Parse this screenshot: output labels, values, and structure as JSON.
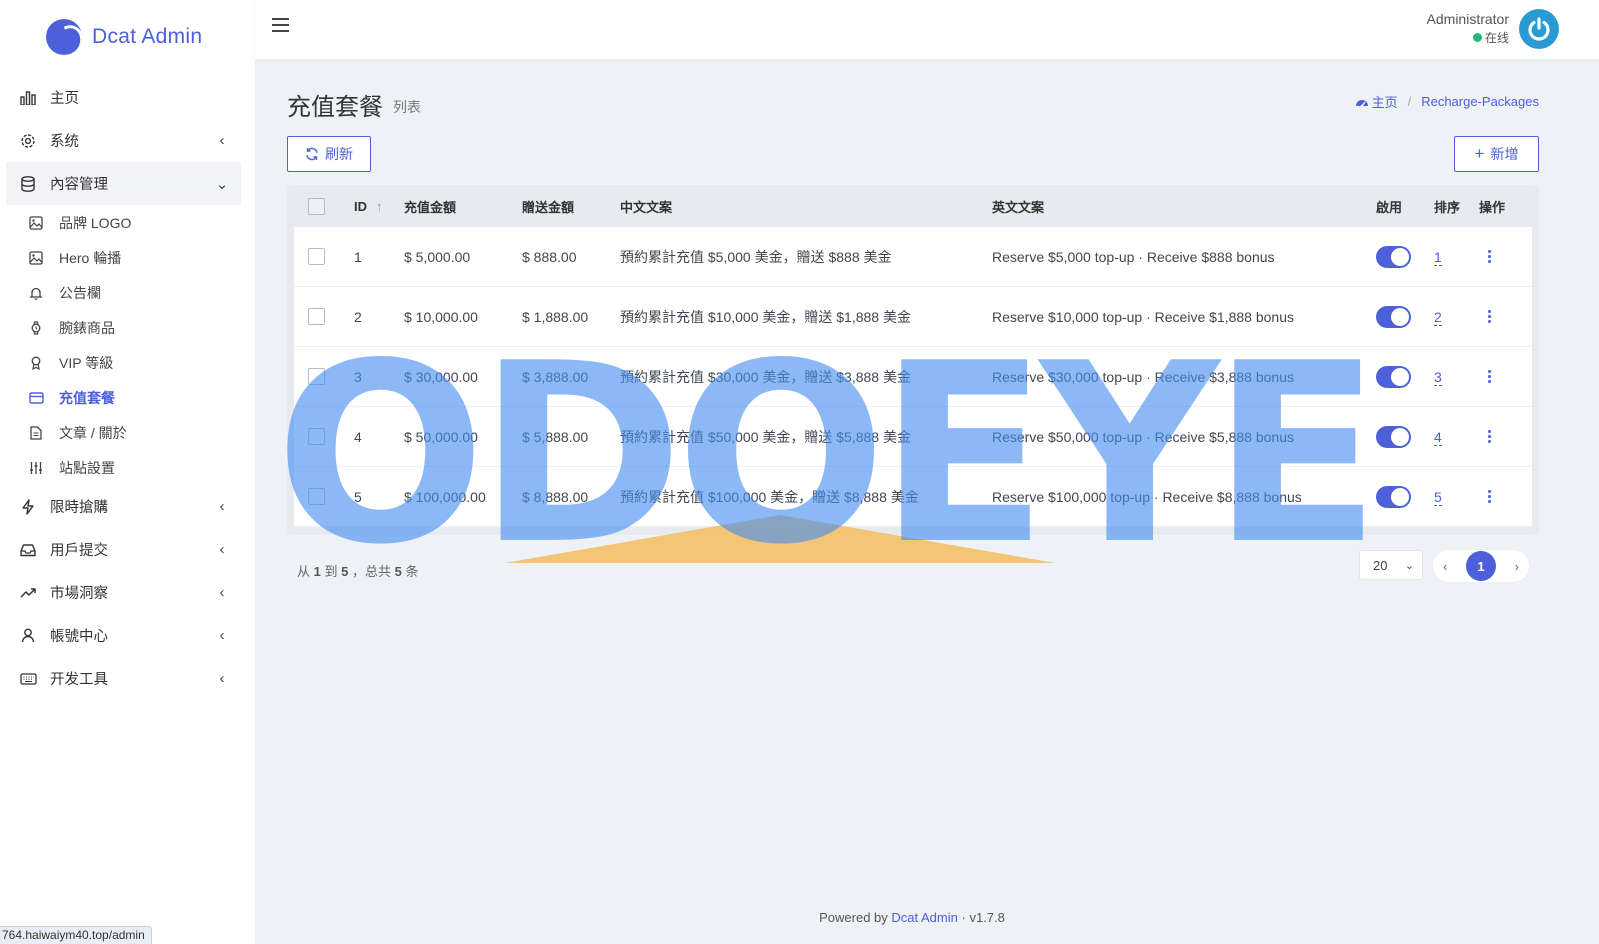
{
  "brand": {
    "name": "Dcat Admin"
  },
  "sidebar": {
    "items": [
      {
        "label": "主页",
        "icon": "bar-chart-icon",
        "arrow": ""
      },
      {
        "label": "系统",
        "icon": "gear-icon",
        "arrow": "‹"
      },
      {
        "label": "內容管理",
        "icon": "database-icon",
        "arrow": "⌄",
        "open": true
      },
      {
        "label": "限時搶購",
        "icon": "lightning-icon",
        "arrow": "‹"
      },
      {
        "label": "用戶提交",
        "icon": "inbox-icon",
        "arrow": "‹"
      },
      {
        "label": "市場洞察",
        "icon": "trending-up-icon",
        "arrow": "‹"
      },
      {
        "label": "帳號中心",
        "icon": "user-icon",
        "arrow": "‹"
      },
      {
        "label": "开发工具",
        "icon": "keyboard-icon",
        "arrow": "‹"
      }
    ],
    "submenu": [
      {
        "label": "品牌 LOGO",
        "icon": "image-icon"
      },
      {
        "label": "Hero 輪播",
        "icon": "image-icon"
      },
      {
        "label": "公告欄",
        "icon": "bell-icon"
      },
      {
        "label": "腕錶商品",
        "icon": "watch-icon"
      },
      {
        "label": "VIP 等級",
        "icon": "award-icon"
      },
      {
        "label": "充值套餐",
        "icon": "credit-card-icon",
        "active": true
      },
      {
        "label": "文章 / 關於",
        "icon": "file-text-icon"
      },
      {
        "label": "站點設置",
        "icon": "sliders-icon"
      }
    ]
  },
  "statusbar": {
    "url": "764.haiwaiym40.top/admin"
  },
  "topbar": {
    "user_name": "Administrator",
    "user_status": "在线"
  },
  "page": {
    "title": "充值套餐",
    "subtitle": "列表",
    "breadcrumb": {
      "home": "主页",
      "current": "Recharge-Packages"
    }
  },
  "toolbar": {
    "refresh_label": "刷新",
    "new_label": "新增"
  },
  "table": {
    "columns": [
      "ID",
      "充值金額",
      "贈送金額",
      "中文文案",
      "英文文案",
      "啟用",
      "排序",
      "操作"
    ],
    "rows": [
      {
        "id": "1",
        "amount": "$ 5,000.00",
        "bonus": "$ 888.00",
        "zh": "預約累計充值 $5,000 美金，贈送 $888 美金",
        "en": "Reserve $5,000 top-up · Receive $888 bonus",
        "enabled": true,
        "sort": "1"
      },
      {
        "id": "2",
        "amount": "$ 10,000.00",
        "bonus": "$ 1,888.00",
        "zh": "預約累計充值 $10,000 美金，贈送 $1,888 美金",
        "en": "Reserve $10,000 top-up · Receive $1,888 bonus",
        "enabled": true,
        "sort": "2"
      },
      {
        "id": "3",
        "amount": "$ 30,000.00",
        "bonus": "$ 3,888.00",
        "zh": "預約累計充值 $30,000 美金，贈送 $3,888 美金",
        "en": "Reserve $30,000 top-up · Receive $3,888 bonus",
        "enabled": true,
        "sort": "3"
      },
      {
        "id": "4",
        "amount": "$ 50,000.00",
        "bonus": "$ 5,888.00",
        "zh": "預約累計充值 $50,000 美金，贈送 $5,888 美金",
        "en": "Reserve $50,000 top-up · Receive $5,888 bonus",
        "enabled": true,
        "sort": "4"
      },
      {
        "id": "5",
        "amount": "$ 100,000.00",
        "bonus": "$ 8,888.00",
        "zh": "預約累計充值 $100,000 美金，贈送 $8,888 美金",
        "en": "Reserve $100,000 top-up · Receive $8,888 bonus",
        "enabled": true,
        "sort": "5"
      }
    ]
  },
  "pager": {
    "prefix": "从",
    "from": "1",
    "to_word": "到",
    "to": "5",
    "total_word": "，总共",
    "total": "5",
    "suffix": "条",
    "per_page": "20",
    "current_page": "1"
  },
  "footer": {
    "powered_by": "Powered by",
    "link": "Dcat Admin",
    "version": "v1.7.8"
  },
  "watermark": {
    "text": "ODOEYE"
  },
  "colors": {
    "accent": "#4c60da",
    "online": "#21b978",
    "avatar": "#2a9ad3"
  }
}
